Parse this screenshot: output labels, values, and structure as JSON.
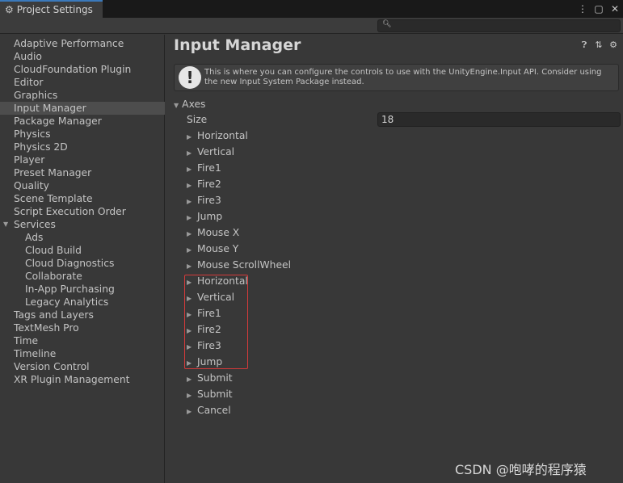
{
  "window": {
    "tab_title": "Project Settings",
    "tab_icon": "gear-icon",
    "controls": [
      "kebab-menu-icon",
      "maximize-icon",
      "close-icon"
    ]
  },
  "search": {
    "placeholder": ""
  },
  "sidebar": {
    "items": [
      {
        "label": "Adaptive Performance"
      },
      {
        "label": "Audio"
      },
      {
        "label": "CloudFoundation Plugin"
      },
      {
        "label": "Editor"
      },
      {
        "label": "Graphics"
      },
      {
        "label": "Input Manager",
        "selected": true
      },
      {
        "label": "Package Manager"
      },
      {
        "label": "Physics"
      },
      {
        "label": "Physics 2D"
      },
      {
        "label": "Player"
      },
      {
        "label": "Preset Manager"
      },
      {
        "label": "Quality"
      },
      {
        "label": "Scene Template"
      },
      {
        "label": "Script Execution Order"
      },
      {
        "label": "Services",
        "expanded": true
      },
      {
        "label": "Ads",
        "child": true
      },
      {
        "label": "Cloud Build",
        "child": true
      },
      {
        "label": "Cloud Diagnostics",
        "child": true
      },
      {
        "label": "Collaborate",
        "child": true
      },
      {
        "label": "In-App Purchasing",
        "child": true
      },
      {
        "label": "Legacy Analytics",
        "child": true
      },
      {
        "label": "Tags and Layers"
      },
      {
        "label": "TextMesh Pro"
      },
      {
        "label": "Time"
      },
      {
        "label": "Timeline"
      },
      {
        "label": "Version Control"
      },
      {
        "label": "XR Plugin Management"
      }
    ]
  },
  "main": {
    "title": "Input Manager",
    "header_icons": [
      "help-icon",
      "preset-icon",
      "settings-gear-icon"
    ],
    "helpbox": {
      "icon": "warning-icon",
      "text": "This is where you can configure the controls to use with the UnityEngine.Input API. Consider using the new Input System Package instead."
    },
    "axes": {
      "label": "Axes",
      "size_label": "Size",
      "size_value": "18",
      "items": [
        "Horizontal",
        "Vertical",
        "Fire1",
        "Fire2",
        "Fire3",
        "Jump",
        "Mouse X",
        "Mouse Y",
        "Mouse ScrollWheel",
        "Horizontal",
        "Vertical",
        "Fire1",
        "Fire2",
        "Fire3",
        "Jump",
        "Submit",
        "Submit",
        "Cancel"
      ]
    },
    "highlight_color": "#d43a3a"
  },
  "watermark": "CSDN @咆哮的程序猿"
}
